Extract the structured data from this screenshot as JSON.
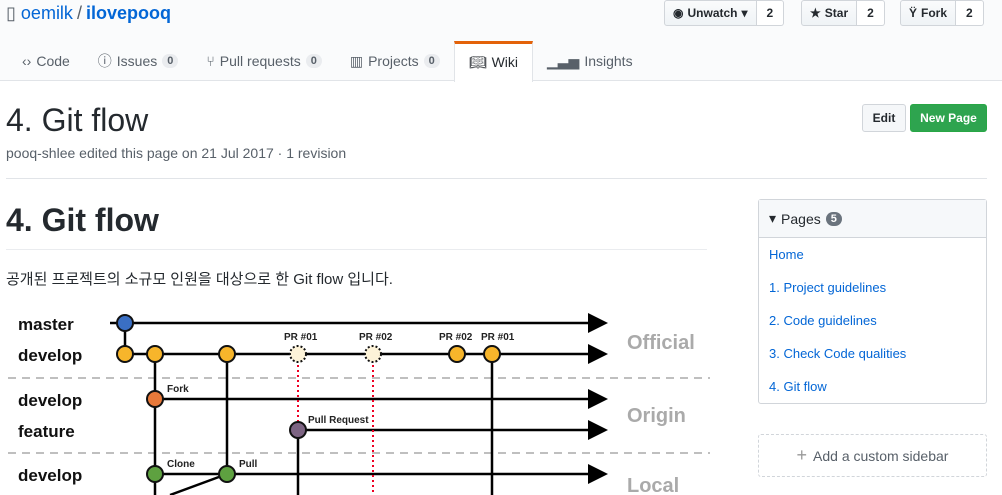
{
  "repo": {
    "owner": "oemilk",
    "name": "ilovepooq"
  },
  "actions": [
    {
      "label": "Unwatch",
      "count": "2"
    },
    {
      "label": "Star",
      "count": "2"
    },
    {
      "label": "Fork",
      "count": "2"
    }
  ],
  "tabs": [
    {
      "label": "Code"
    },
    {
      "label": "Issues",
      "count": "0"
    },
    {
      "label": "Pull requests",
      "count": "0"
    },
    {
      "label": "Projects",
      "count": "0"
    },
    {
      "label": "Wiki"
    },
    {
      "label": "Insights"
    }
  ],
  "page": {
    "title": "4. Git flow",
    "meta": "pooq-shlee edited this page on 21 Jul 2017 · 1 revision",
    "edit": "Edit",
    "new_page": "New Page",
    "heading": "4. Git flow",
    "intro": "공개된 프로젝트의 소규모 인원을 대상으로 한 Git flow 입니다."
  },
  "diagram": {
    "branches": [
      "master",
      "develop",
      "develop",
      "feature",
      "develop"
    ],
    "zones": [
      "Official",
      "Origin",
      "Local"
    ],
    "pr_labels": [
      "PR #01",
      "PR #02",
      "PR #02",
      "PR #01"
    ],
    "events": [
      "Fork",
      "Pull Request",
      "Clone",
      "Pull"
    ]
  },
  "sidebar": {
    "title": "Pages",
    "count": "5",
    "pages": [
      "Home",
      "1. Project guidelines",
      "2. Code guidelines",
      "3. Check Code qualities",
      "4. Git flow"
    ],
    "custom": "Add a custom sidebar"
  }
}
